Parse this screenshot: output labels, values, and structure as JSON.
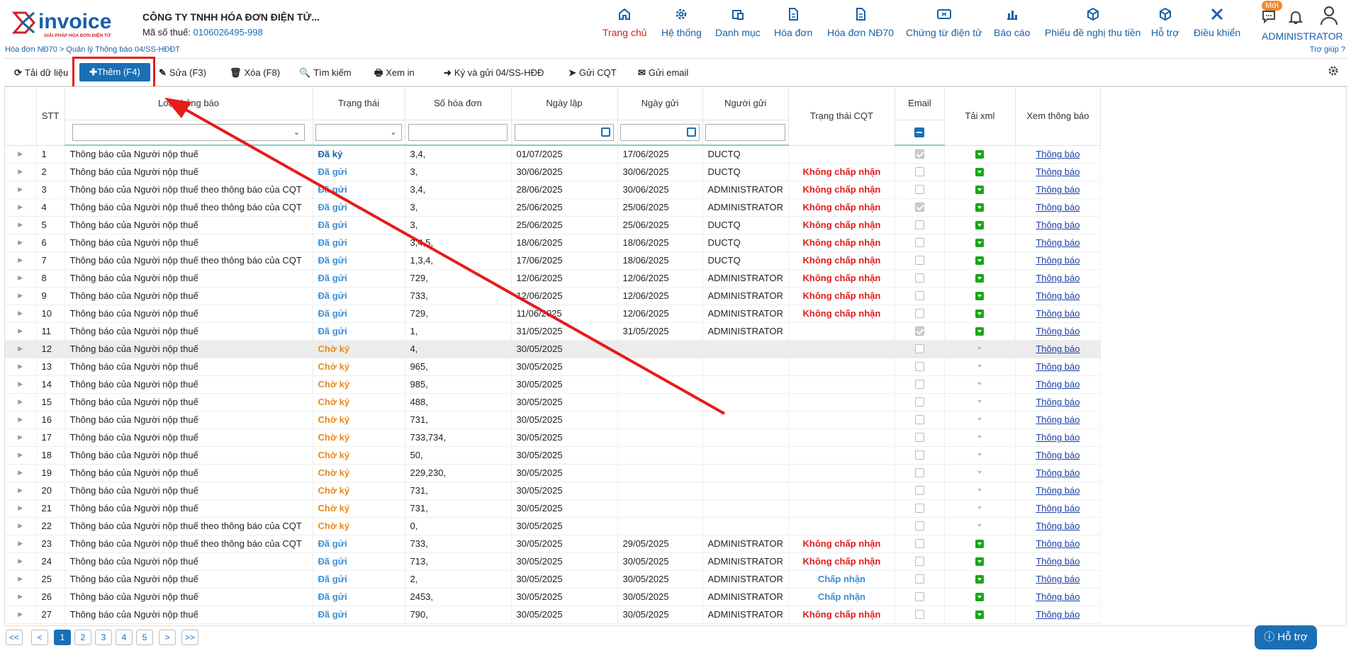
{
  "header": {
    "logo_text": "invoice",
    "logo_tagline": "GIẢI PHÁP HÓA ĐƠN ĐIỆN TỬ",
    "company": "CÔNG TY TNHH HÓA ĐƠN ĐIỆN TỬ...",
    "tax_label": "Mã số thuế: ",
    "tax_code": "0106026495-998",
    "nav": [
      "Trang chủ",
      "Hệ thống",
      "Danh mục",
      "Hóa đơn",
      "Hóa đơn NĐ70",
      "Chứng từ điện tử",
      "Báo cáo",
      "Phiếu đề nghị thu tiền",
      "Hỗ trợ",
      "Điều khiển"
    ],
    "badge": "Mới",
    "user": "ADMINISTRATOR"
  },
  "breadcrumb": "Hóa đơn NĐ70 > Quản lý Thông báo 04/SS-HĐĐT",
  "help": "Trợ giúp ?",
  "toolbar": {
    "reload": "Tải dữ liệu",
    "add": "Thêm (F4)",
    "edit": "Sửa (F3)",
    "delete": "Xóa (F8)",
    "search": "Tìm kiếm",
    "print": "Xem in",
    "sign_send": "Ký và gửi 04/SS-HĐĐ",
    "send_cqt": "Gửi CQT",
    "send_email": "Gửi email"
  },
  "columns": {
    "stt": "STT",
    "type": "Loại thông báo",
    "status": "Trạng thái",
    "invoice_no": "Số hóa đơn",
    "created": "Ngày lập",
    "sent": "Ngày gửi",
    "sender": "Người gửi",
    "cqt": "Trạng thái CQT",
    "email": "Email",
    "xml": "Tải xml",
    "view": "Xem thông báo"
  },
  "rows": [
    {
      "stt": "1",
      "type": "Thông báo của Người nộp thuế",
      "status": "Đã ký",
      "st": "ky",
      "no": "3,4,",
      "created": "01/07/2025",
      "sent": "17/06/2025",
      "sender": "DUCTQ",
      "cqt": "",
      "email": true,
      "xml": true,
      "view": "Thông báo"
    },
    {
      "stt": "2",
      "type": "Thông báo của Người nộp thuế",
      "status": "Đã gửi",
      "st": "gui",
      "no": "3,",
      "created": "30/06/2025",
      "sent": "30/06/2025",
      "sender": "DUCTQ",
      "cqt": "Không chấp nhận",
      "email": false,
      "xml": true,
      "view": "Thông báo"
    },
    {
      "stt": "3",
      "type": "Thông báo của Người nộp thuế theo thông báo của CQT",
      "status": "Đã gửi",
      "st": "gui",
      "no": "3,4,",
      "created": "28/06/2025",
      "sent": "30/06/2025",
      "sender": "ADMINISTRATOR",
      "cqt": "Không chấp nhận",
      "email": false,
      "xml": true,
      "view": "Thông báo"
    },
    {
      "stt": "4",
      "type": "Thông báo của Người nộp thuế theo thông báo của CQT",
      "status": "Đã gửi",
      "st": "gui",
      "no": "3,",
      "created": "25/06/2025",
      "sent": "25/06/2025",
      "sender": "ADMINISTRATOR",
      "cqt": "Không chấp nhận",
      "email": true,
      "xml": true,
      "view": "Thông báo"
    },
    {
      "stt": "5",
      "type": "Thông báo của Người nộp thuế",
      "status": "Đã gửi",
      "st": "gui",
      "no": "3,",
      "created": "25/06/2025",
      "sent": "25/06/2025",
      "sender": "DUCTQ",
      "cqt": "Không chấp nhận",
      "email": false,
      "xml": true,
      "view": "Thông báo"
    },
    {
      "stt": "6",
      "type": "Thông báo của Người nộp thuế",
      "status": "Đã gửi",
      "st": "gui",
      "no": "3,4,5,",
      "created": "18/06/2025",
      "sent": "18/06/2025",
      "sender": "DUCTQ",
      "cqt": "Không chấp nhận",
      "email": false,
      "xml": true,
      "view": "Thông báo"
    },
    {
      "stt": "7",
      "type": "Thông báo của Người nộp thuế theo thông báo của CQT",
      "status": "Đã gửi",
      "st": "gui",
      "no": "1,3,4,",
      "created": "17/06/2025",
      "sent": "18/06/2025",
      "sender": "DUCTQ",
      "cqt": "Không chấp nhận",
      "email": false,
      "xml": true,
      "view": "Thông báo"
    },
    {
      "stt": "8",
      "type": "Thông báo của Người nộp thuế",
      "status": "Đã gửi",
      "st": "gui",
      "no": "729,",
      "created": "12/06/2025",
      "sent": "12/06/2025",
      "sender": "ADMINISTRATOR",
      "cqt": "Không chấp nhận",
      "email": false,
      "xml": true,
      "view": "Thông báo"
    },
    {
      "stt": "9",
      "type": "Thông báo của Người nộp thuế",
      "status": "Đã gửi",
      "st": "gui",
      "no": "733,",
      "created": "12/06/2025",
      "sent": "12/06/2025",
      "sender": "ADMINISTRATOR",
      "cqt": "Không chấp nhận",
      "email": false,
      "xml": true,
      "view": "Thông báo"
    },
    {
      "stt": "10",
      "type": "Thông báo của Người nộp thuế",
      "status": "Đã gửi",
      "st": "gui",
      "no": "729,",
      "created": "11/06/2025",
      "sent": "12/06/2025",
      "sender": "ADMINISTRATOR",
      "cqt": "Không chấp nhận",
      "email": false,
      "xml": true,
      "view": "Thông báo"
    },
    {
      "stt": "11",
      "type": "Thông báo của Người nộp thuế",
      "status": "Đã gửi",
      "st": "gui",
      "no": "1,",
      "created": "31/05/2025",
      "sent": "31/05/2025",
      "sender": "ADMINISTRATOR",
      "cqt": "",
      "email": true,
      "xml": true,
      "view": "Thông báo"
    },
    {
      "stt": "12",
      "type": "Thông báo của Người nộp thuế",
      "status": "Chờ ký",
      "st": "cho",
      "no": "4,",
      "created": "30/05/2025",
      "sent": "",
      "sender": "",
      "cqt": "",
      "email": false,
      "xml": false,
      "view": "Thông báo",
      "sel": true
    },
    {
      "stt": "13",
      "type": "Thông báo của Người nộp thuế",
      "status": "Chờ ký",
      "st": "cho",
      "no": "965,",
      "created": "30/05/2025",
      "sent": "",
      "sender": "",
      "cqt": "",
      "email": false,
      "xml": false,
      "view": "Thông báo"
    },
    {
      "stt": "14",
      "type": "Thông báo của Người nộp thuế",
      "status": "Chờ ký",
      "st": "cho",
      "no": "985,",
      "created": "30/05/2025",
      "sent": "",
      "sender": "",
      "cqt": "",
      "email": false,
      "xml": false,
      "view": "Thông báo"
    },
    {
      "stt": "15",
      "type": "Thông báo của Người nộp thuế",
      "status": "Chờ ký",
      "st": "cho",
      "no": "488,",
      "created": "30/05/2025",
      "sent": "",
      "sender": "",
      "cqt": "",
      "email": false,
      "xml": false,
      "view": "Thông báo"
    },
    {
      "stt": "16",
      "type": "Thông báo của Người nộp thuế",
      "status": "Chờ ký",
      "st": "cho",
      "no": "731,",
      "created": "30/05/2025",
      "sent": "",
      "sender": "",
      "cqt": "",
      "email": false,
      "xml": false,
      "view": "Thông báo"
    },
    {
      "stt": "17",
      "type": "Thông báo của Người nộp thuế",
      "status": "Chờ ký",
      "st": "cho",
      "no": "733,734,",
      "created": "30/05/2025",
      "sent": "",
      "sender": "",
      "cqt": "",
      "email": false,
      "xml": false,
      "view": "Thông báo"
    },
    {
      "stt": "18",
      "type": "Thông báo của Người nộp thuế",
      "status": "Chờ ký",
      "st": "cho",
      "no": "50,",
      "created": "30/05/2025",
      "sent": "",
      "sender": "",
      "cqt": "",
      "email": false,
      "xml": false,
      "view": "Thông báo"
    },
    {
      "stt": "19",
      "type": "Thông báo của Người nộp thuế",
      "status": "Chờ ký",
      "st": "cho",
      "no": "229,230,",
      "created": "30/05/2025",
      "sent": "",
      "sender": "",
      "cqt": "",
      "email": false,
      "xml": false,
      "view": "Thông báo"
    },
    {
      "stt": "20",
      "type": "Thông báo của Người nộp thuế",
      "status": "Chờ ký",
      "st": "cho",
      "no": "731,",
      "created": "30/05/2025",
      "sent": "",
      "sender": "",
      "cqt": "",
      "email": false,
      "xml": false,
      "view": "Thông báo"
    },
    {
      "stt": "21",
      "type": "Thông báo của Người nộp thuế",
      "status": "Chờ ký",
      "st": "cho",
      "no": "731,",
      "created": "30/05/2025",
      "sent": "",
      "sender": "",
      "cqt": "",
      "email": false,
      "xml": false,
      "view": "Thông báo"
    },
    {
      "stt": "22",
      "type": "Thông báo của Người nộp thuế theo thông báo của CQT",
      "status": "Chờ ký",
      "st": "cho",
      "no": "0,",
      "created": "30/05/2025",
      "sent": "",
      "sender": "",
      "cqt": "",
      "email": false,
      "xml": false,
      "view": "Thông báo"
    },
    {
      "stt": "23",
      "type": "Thông báo của Người nộp thuế theo thông báo của CQT",
      "status": "Đã gửi",
      "st": "gui",
      "no": "733,",
      "created": "30/05/2025",
      "sent": "29/05/2025",
      "sender": "ADMINISTRATOR",
      "cqt": "Không chấp nhận",
      "email": false,
      "xml": true,
      "view": "Thông báo"
    },
    {
      "stt": "24",
      "type": "Thông báo của Người nộp thuế",
      "status": "Đã gửi",
      "st": "gui",
      "no": "713,",
      "created": "30/05/2025",
      "sent": "30/05/2025",
      "sender": "ADMINISTRATOR",
      "cqt": "Không chấp nhận",
      "email": false,
      "xml": true,
      "view": "Thông báo"
    },
    {
      "stt": "25",
      "type": "Thông báo của Người nộp thuế",
      "status": "Đã gửi",
      "st": "gui",
      "no": "2,",
      "created": "30/05/2025",
      "sent": "30/05/2025",
      "sender": "ADMINISTRATOR",
      "cqt": "Chấp nhận",
      "email": false,
      "xml": true,
      "view": "Thông báo"
    },
    {
      "stt": "26",
      "type": "Thông báo của Người nộp thuế",
      "status": "Đã gửi",
      "st": "gui",
      "no": "2453,",
      "created": "30/05/2025",
      "sent": "30/05/2025",
      "sender": "ADMINISTRATOR",
      "cqt": "Chấp nhận",
      "email": false,
      "xml": true,
      "view": "Thông báo"
    },
    {
      "stt": "27",
      "type": "Thông báo của Người nộp thuế",
      "status": "Đã gửi",
      "st": "gui",
      "no": "790,",
      "created": "30/05/2025",
      "sent": "30/05/2025",
      "sender": "ADMINISTRATOR",
      "cqt": "Không chấp nhận",
      "email": false,
      "xml": true,
      "view": "Thông báo"
    }
  ],
  "pager": {
    "first": "<<",
    "prev": "<",
    "pages": [
      "1",
      "2",
      "3",
      "4",
      "5"
    ],
    "next": ">",
    "last": ">>"
  },
  "support": "Hỗ trợ",
  "colors": {
    "accent": "#1a6fb5",
    "nav_active": "#d0202a",
    "reject": "#e01c1c",
    "accept": "#3a8fd6",
    "pending": "#e88a1a",
    "highlight": "#e81a1a"
  }
}
